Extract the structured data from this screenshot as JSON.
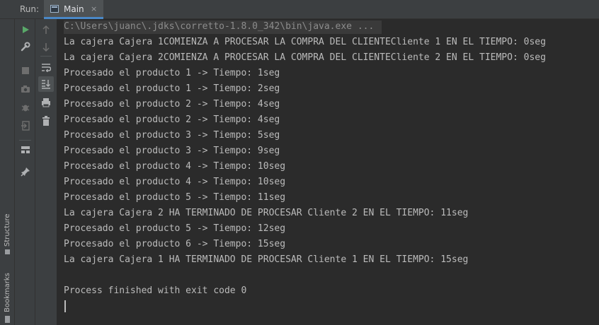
{
  "topbar": {
    "run_label": "Run:",
    "tab_label": "Main",
    "tab_close": "×"
  },
  "left_strip": {
    "structure_label": "Structure",
    "bookmarks_label": "Bookmarks"
  },
  "console": {
    "command": "C:\\Users\\juanc\\.jdks\\corretto-1.8.0_342\\bin\\java.exe ...",
    "lines": [
      "La cajera Cajera 1COMIENZA A PROCESAR LA COMPRA DEL CLIENTECliente 1 EN EL TIEMPO: 0seg",
      "La cajera Cajera 2COMIENZA A PROCESAR LA COMPRA DEL CLIENTECliente 2 EN EL TIEMPO: 0seg",
      "Procesado el producto 1 -> Tiempo: 1seg",
      "Procesado el producto 1 -> Tiempo: 2seg",
      "Procesado el producto 2 -> Tiempo: 4seg",
      "Procesado el producto 2 -> Tiempo: 4seg",
      "Procesado el producto 3 -> Tiempo: 5seg",
      "Procesado el producto 3 -> Tiempo: 9seg",
      "Procesado el producto 4 -> Tiempo: 10seg",
      "Procesado el producto 4 -> Tiempo: 10seg",
      "Procesado el producto 5 -> Tiempo: 11seg",
      "La cajera Cajera 2 HA TERMINADO DE PROCESAR Cliente 2 EN EL TIEMPO: 11seg",
      "Procesado el producto 5 -> Tiempo: 12seg",
      "Procesado el producto 6 -> Tiempo: 15seg",
      "La cajera Cajera 1 HA TERMINADO DE PROCESAR Cliente 1 EN EL TIEMPO: 15seg",
      "",
      "Process finished with exit code 0"
    ]
  },
  "toolbar_left": [
    "rerun-icon",
    "wrench-icon",
    "stop-icon",
    "camera-icon",
    "debug-icon",
    "exit-icon",
    "layout-icon",
    "pin-icon"
  ],
  "toolbar_right": [
    "up-arrow-icon",
    "down-arrow-icon",
    "soft-wrap-icon",
    "scroll-to-end-icon",
    "print-icon",
    "trash-icon"
  ],
  "colors": {
    "background": "#2b2b2b",
    "panel": "#3c3f41",
    "text": "#bbbbbb",
    "run_green": "#59a869",
    "tab_accent": "#4a88c7"
  }
}
